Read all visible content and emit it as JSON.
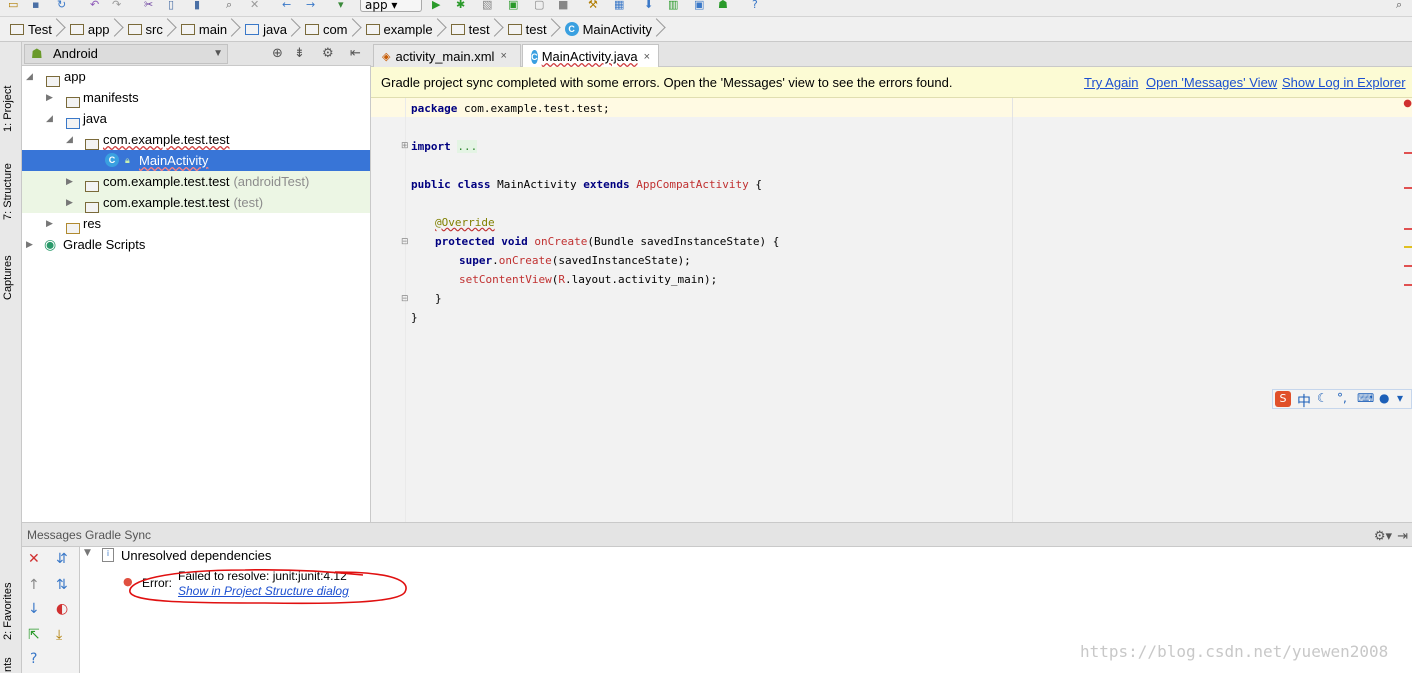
{
  "toolbar": {
    "run_config": "app"
  },
  "breadcrumb": [
    "Test",
    "app",
    "src",
    "main",
    "java",
    "com",
    "example",
    "test",
    "test",
    "MainActivity"
  ],
  "left_strip": [
    "1: Project",
    "7: Structure",
    "Captures",
    "2: Favorites",
    "nts"
  ],
  "project": {
    "view_mode": "Android",
    "tree": {
      "app": "app",
      "manifests": "manifests",
      "java": "java",
      "pkg_main": "com.example.test.test",
      "main_activity": "MainActivity",
      "pkg_android_test": "com.example.test.test",
      "android_test_suffix": "(androidTest)",
      "pkg_test": "com.example.test.test",
      "test_suffix": "(test)",
      "res": "res",
      "gradle": "Gradle Scripts"
    }
  },
  "editor": {
    "tabs": [
      {
        "label": "activity_main.xml",
        "close": "×"
      },
      {
        "label": "MainActivity.java",
        "close": "×"
      }
    ],
    "notification": {
      "text": "Gradle project sync completed with some errors. Open the 'Messages' view to see the errors found.",
      "links": [
        "Try Again",
        "Open 'Messages' View",
        "Show Log in Explorer"
      ]
    },
    "code": {
      "package_kw": "package",
      "package_name": " com.example.test.test;",
      "import_kw": "import",
      "import_fold": "...",
      "public_kw": "public",
      "class_kw": "class",
      "class_name": " MainActivity ",
      "extends_kw": "extends",
      "superclass": "AppCompatActivity",
      "brace_open": " {",
      "override": "@Override",
      "protected_kw": "protected",
      "void_kw": "void",
      "method": "onCreate",
      "params": "(Bundle savedInstanceState) {",
      "super_kw": "super",
      "super_dot": ".",
      "super_call": "onCreate",
      "super_args": "(savedInstanceState);",
      "setcv": "setContentView",
      "setcv_r": "R",
      "setcv_args": ".layout.activity_main);",
      "close_method": "}",
      "close_class": "}"
    }
  },
  "messages": {
    "title": "Messages Gradle Sync",
    "group": "Unresolved dependencies",
    "error_label": "Error:",
    "error_text": "Failed to resolve: junit:junit:4.12",
    "error_link": "Show in Project Structure dialog"
  },
  "ime": {
    "lang": "中"
  },
  "watermark": "https://blog.csdn.net/yuewen2008"
}
